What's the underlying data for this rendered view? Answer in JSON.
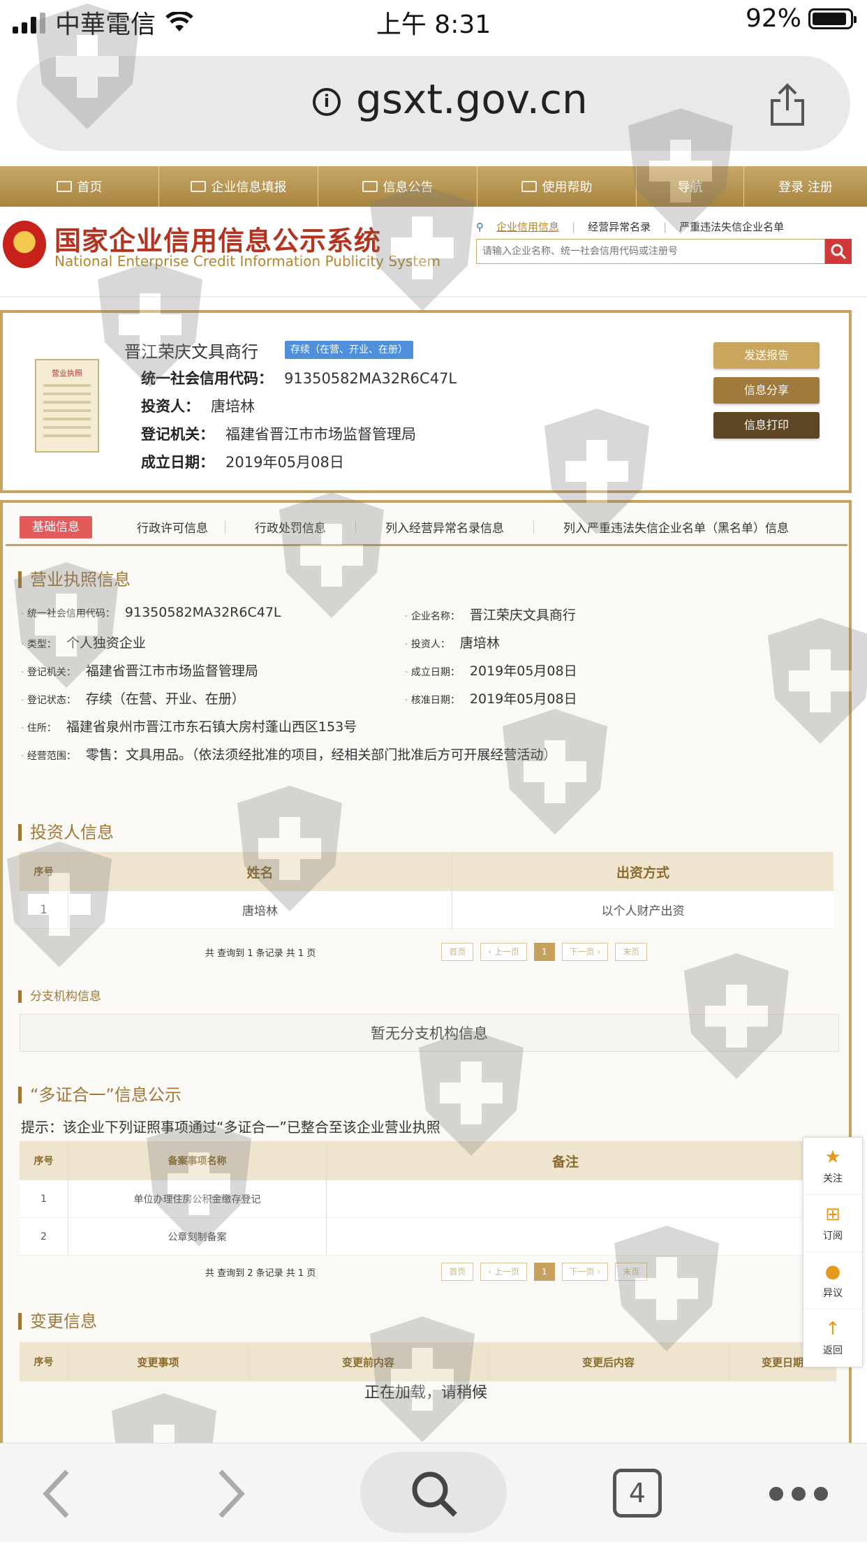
{
  "status_bar": {
    "carrier": "中華電信",
    "time": "上午 8:31",
    "battery": "92%"
  },
  "browser": {
    "url": "gsxt.gov.cn",
    "tab_count": "4"
  },
  "site_nav": {
    "items": [
      {
        "label": "首页"
      },
      {
        "label": "企业信息填报"
      },
      {
        "label": "信息公告"
      },
      {
        "label": "使用帮助"
      },
      {
        "label": "导航"
      },
      {
        "label": "登录  注册"
      }
    ]
  },
  "header": {
    "title_cn": "国家企业信用信息公示系统",
    "title_en": "National Enterprise Credit Information Publicity System",
    "search_tabs": [
      "企业信用信息",
      "经营异常名录",
      "严重违法失信企业名单"
    ],
    "search_placeholder": "请输入企业名称、统一社会信用代码或注册号"
  },
  "company": {
    "license_title": "营业执照",
    "name": "晋江荣庆文具商行",
    "status": "存续（在营、开业、在册）",
    "rows": [
      {
        "label": "统一社会信用代码：",
        "value": "91350582MA32R6C47L"
      },
      {
        "label": "投资人：",
        "value": "唐培林"
      },
      {
        "label": "登记机关：",
        "value": "福建省晋江市市场监督管理局"
      },
      {
        "label": "成立日期：",
        "value": "2019年05月08日"
      }
    ],
    "buttons": [
      "发送报告",
      "信息分享",
      "信息打印"
    ]
  },
  "tabs": [
    "基础信息",
    "行政许可信息",
    "行政处罚信息",
    "列入经营异常名录信息",
    "列入严重违法失信企业名单（黑名单）信息"
  ],
  "business_license": {
    "title": "营业执照信息",
    "fields": {
      "credit_code_k": "统一社会信用代码：",
      "credit_code_v": "91350582MA32R6C47L",
      "name_k": "企业名称：",
      "name_v": "晋江荣庆文具商行",
      "type_k": "类型：",
      "type_v": "个人独资企业",
      "investor_k": "投资人：",
      "investor_v": "唐培林",
      "authority_k": "登记机关：",
      "authority_v": "福建省晋江市市场监督管理局",
      "founded_k": "成立日期：",
      "founded_v": "2019年05月08日",
      "reg_status_k": "登记状态：",
      "reg_status_v": "存续（在营、开业、在册）",
      "approved_k": "核准日期：",
      "approved_v": "2019年05月08日",
      "address_k": "住所：",
      "address_v": "福建省泉州市晋江市东石镇大房村蓬山西区153号",
      "scope_k": "经营范围：",
      "scope_v": "零售：文具用品。（依法须经批准的项目，经相关部门批准后方可开展经营活动）"
    }
  },
  "investors": {
    "title": "投资人信息",
    "columns": [
      "序号",
      "姓名",
      "出资方式"
    ],
    "rows": [
      [
        "1",
        "唐培林",
        "以个人财产出资"
      ]
    ],
    "pager_info": "共 查询到 1 条记录 共 1 页"
  },
  "pager": {
    "first": "首页",
    "prev": "‹ 上一页",
    "current": "1",
    "next": "下一页 ›",
    "last": "末页"
  },
  "branches": {
    "title": "分支机构信息",
    "empty": "暂无分支机构信息"
  },
  "multi_cert": {
    "title": "“多证合一”信息公示",
    "hint": "提示：该企业下列证照事项通过“多证合一”已整合至该企业营业执照",
    "columns": [
      "序号",
      "备案事项名称",
      "备注"
    ],
    "rows": [
      [
        "1",
        "单位办理住房公积金缴存登记",
        ""
      ],
      [
        "2",
        "公章刻制备案",
        ""
      ]
    ],
    "pager_info": "共 查询到 2 条记录 共 1 页"
  },
  "changes": {
    "title": "变更信息",
    "columns": [
      "序号",
      "变更事项",
      "变更前内容",
      "变更后内容",
      "变更日期"
    ],
    "loading": "正在加载，请稍候"
  },
  "side_menu": [
    "关注",
    "订阅",
    "异议",
    "返回"
  ],
  "colors": {
    "gold": "#c6a25e",
    "brown_text": "#a0783a",
    "red_badge": "#e25a5a",
    "blue_badge": "#4f8fdc"
  }
}
